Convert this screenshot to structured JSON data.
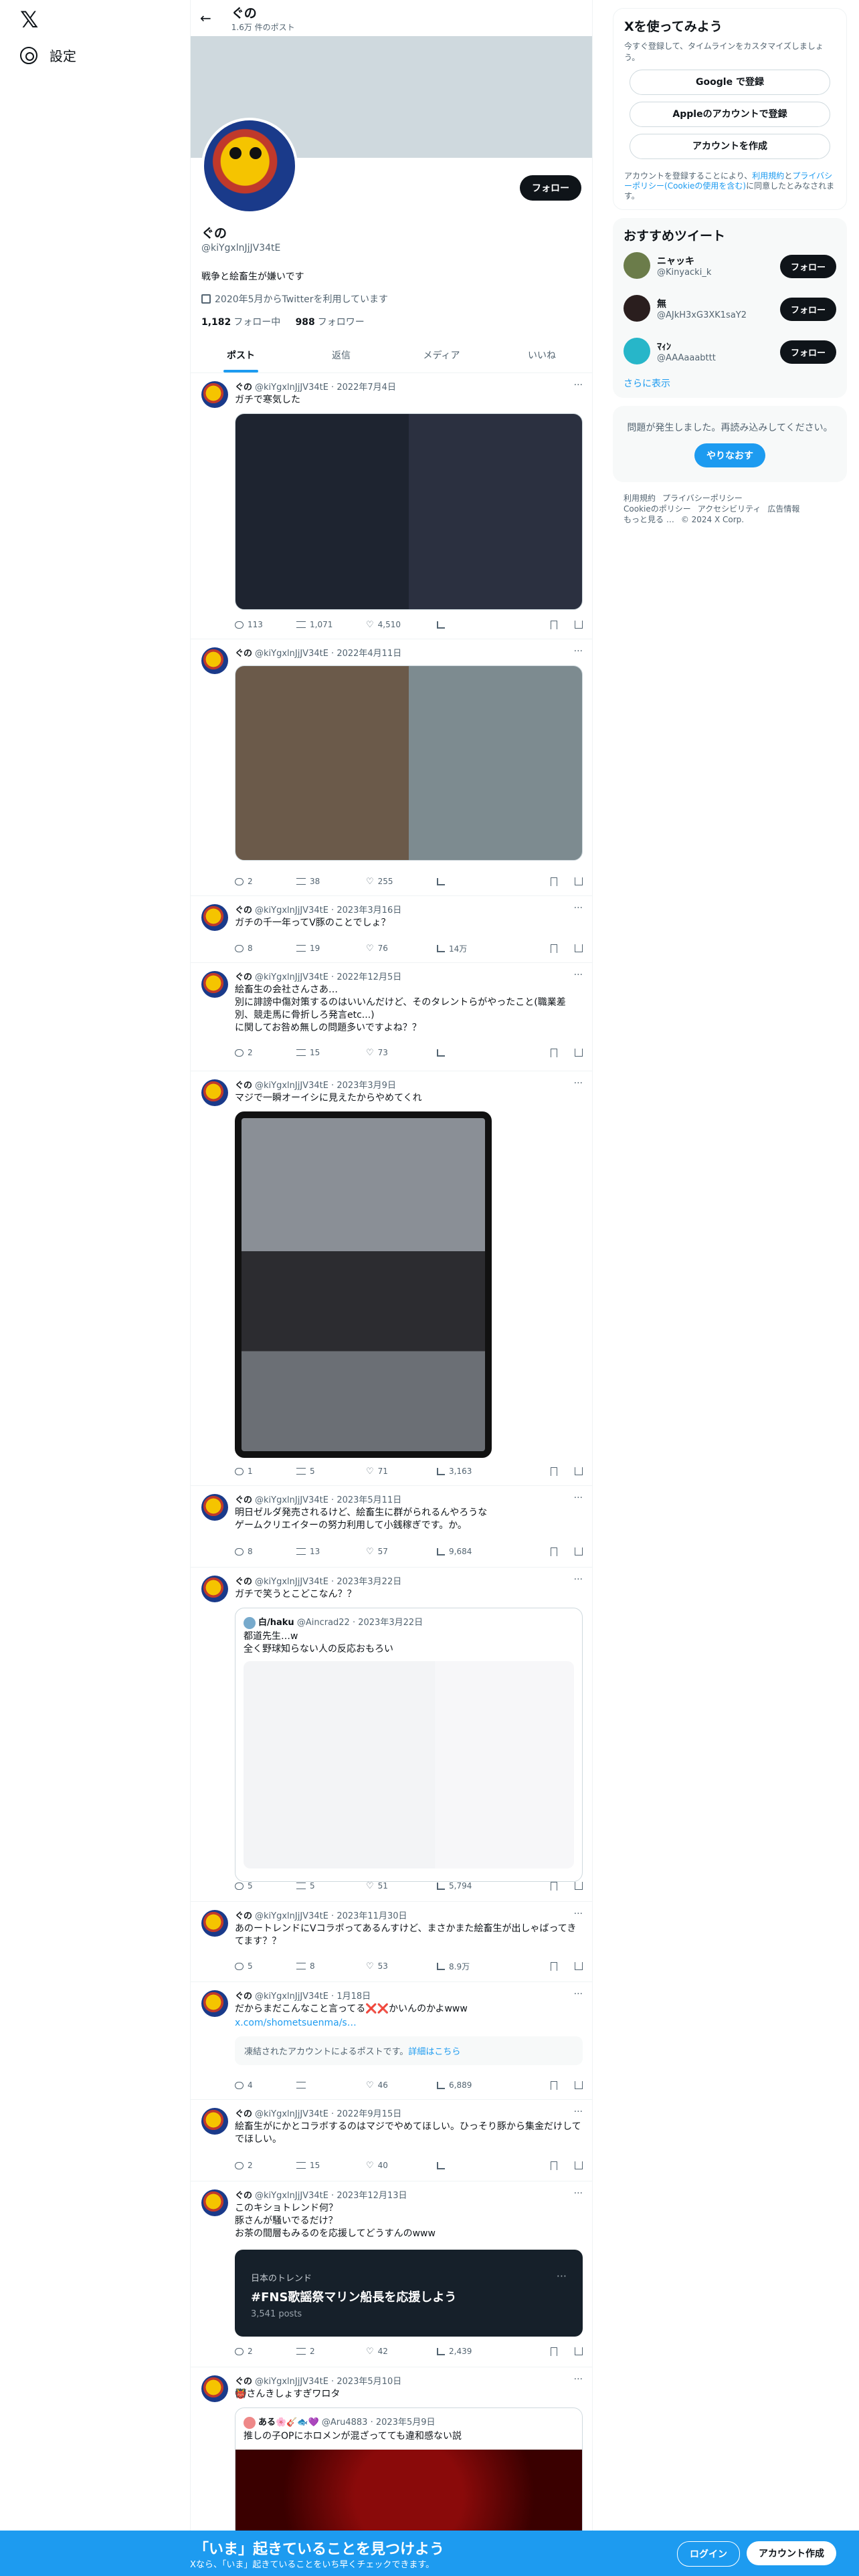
{
  "nav": {
    "logo": "𝕏",
    "settings": "設定"
  },
  "header": {
    "name": "ぐの",
    "posts": "1.6万 件のポスト"
  },
  "profile": {
    "name": "ぐの",
    "handle": "@kiYgxlnJjJV34tE",
    "bio": "戦争と絵畜生が嫌いです",
    "joined": "2020年5月からTwitterを利用しています",
    "following_count": "1,182",
    "following_label": "フォロー中",
    "followers_count": "988",
    "followers_label": "フォロワー",
    "follow_button": "フォロー"
  },
  "tabs": [
    "ポスト",
    "返信",
    "メディア",
    "いいね"
  ],
  "tweets": [
    {
      "name": "ぐの",
      "handle": "@kiYgxlnJjJV34tE",
      "date": "2022年7月4日",
      "text": "ガチで寒気した",
      "reply": "113",
      "rt": "1,071",
      "like": "4,510",
      "view": ""
    },
    {
      "name": "ぐの",
      "handle": "@kiYgxlnJjJV34tE",
      "date": "2022年4月11日",
      "text": "",
      "reply": "2",
      "rt": "38",
      "like": "255",
      "view": ""
    },
    {
      "name": "ぐの",
      "handle": "@kiYgxlnJjJV34tE",
      "date": "2023年3月16日",
      "text": "ガチの千一年ってV豚のことでしょ？",
      "reply": "8",
      "rt": "19",
      "like": "76",
      "view": "14万"
    },
    {
      "name": "ぐの",
      "handle": "@kiYgxlnJjJV34tE",
      "date": "2022年12月5日",
      "text": "絵畜生の会社さんさあ…\n別に誹謗中傷対策するのはいいんだけど、そのタレントらがやったこと(職業差別、競走馬に骨折しろ発言etc...)\nに関してお咎め無しの問題多いですよね？？",
      "reply": "2",
      "rt": "15",
      "like": "73",
      "view": ""
    },
    {
      "name": "ぐの",
      "handle": "@kiYgxlnJjJV34tE",
      "date": "2023年3月9日",
      "text": "マジで一瞬オーイシに見えたからやめてくれ",
      "reply": "1",
      "rt": "5",
      "like": "71",
      "view": "3,163"
    },
    {
      "name": "ぐの",
      "handle": "@kiYgxlnJjJV34tE",
      "date": "2023年5月11日",
      "text": "明日ゼルダ発売されるけど、絵畜生に群がられるんやろうな\nゲームクリエイターの努力利用して小銭稼ぎです。か。",
      "reply": "8",
      "rt": "13",
      "like": "57",
      "view": "9,684"
    },
    {
      "name": "ぐの",
      "handle": "@kiYgxlnJjJV34tE",
      "date": "2023年3月22日",
      "text": "ガチで笑うとこどこなん？？",
      "reply": "5",
      "rt": "5",
      "like": "51",
      "view": "5,794",
      "quote_name": "白/haku",
      "quote_handle": "@Aincrad22",
      "quote_date": "2023年3月22日",
      "quote_text": "都道先生…w\n全く野球知らない人の反応おもろい"
    },
    {
      "name": "ぐの",
      "handle": "@kiYgxlnJjJV34tE",
      "date": "2023年11月30日",
      "text": "あのートレンドにVコラボってあるんすけど、まさかまた絵畜生が出しゃばってきてます？？",
      "reply": "5",
      "rt": "8",
      "like": "53",
      "view": "8.9万"
    },
    {
      "name": "ぐの",
      "handle": "@kiYgxlnJjJV34tE",
      "date": "1月18日",
      "text": "だからまだこんなこと言ってる❌❌かいんのかよwww",
      "link": "x.com/shometsuenma/s…",
      "notice": "凍結されたアカウントによるポストです。",
      "notice_link": "詳細はこちら",
      "reply": "4",
      "rt": "",
      "like": "46",
      "view": "6,889"
    },
    {
      "name": "ぐの",
      "handle": "@kiYgxlnJjJV34tE",
      "date": "2022年9月15日",
      "text": "絵畜生がにかとコラボするのはマジでやめてほしい。ひっそり豚から集金だけしてでほしい。",
      "reply": "2",
      "rt": "15",
      "like": "40",
      "view": ""
    },
    {
      "name": "ぐの",
      "handle": "@kiYgxlnJjJV34tE",
      "date": "2023年12月13日",
      "text": "このキショトレンド何？\n豚さんが騒いでるだけ？\nお茶の間層もみるのを応援してどうすんのwww",
      "trend_label": "日本のトレンド",
      "trend_name": "#FNS歌謡祭マリン船長を応援しよう",
      "trend_posts": "3,541 posts",
      "reply": "2",
      "rt": "2",
      "like": "42",
      "view": "2,439"
    },
    {
      "name": "ぐの",
      "handle": "@kiYgxlnJjJV34tE",
      "date": "2023年5月10日",
      "text": "👹さんきしょすぎワロタ",
      "quote_name": "ある🌸🎸🐟💜",
      "quote_handle": "@Aru4883",
      "quote_date": "2023年5月9日",
      "quote_text": "推しの子OPにホロメンが混ざってても違和感ない説"
    }
  ],
  "sidebar": {
    "signup_title": "Xを使ってみよう",
    "signup_sub": "今すぐ登録して、タイムラインをカスタマイズしましょう。",
    "google": "Google で登録",
    "apple": "Appleのアカウントで登録",
    "create": "アカウントを作成",
    "terms_prefix": "アカウントを登録することにより、",
    "terms_link1": "利用規約",
    "terms_mid": "と",
    "terms_link2": "プライバシーポリシー",
    "terms_link3": "(Cookieの使用を含む)",
    "terms_suffix": "に同意したとみなされます。",
    "rec_title": "おすすめツイート",
    "recs": [
      {
        "name": "ニャッキ",
        "handle": "@Kinyacki_k",
        "btn": "フォロー"
      },
      {
        "name": "無",
        "handle": "@AJkH3xG3XK1saY2",
        "btn": "フォロー"
      },
      {
        "name": "ﾏｨﾝ",
        "handle": "@AAAaaabttt",
        "btn": "フォロー"
      }
    ],
    "show_more": "さらに表示",
    "error": "問題が発生しました。再読み込みしてください。",
    "retry": "やりなおす",
    "footer": [
      "利用規約",
      "プライバシーポリシー",
      "Cookieのポリシー",
      "アクセシビリティ",
      "広告情報",
      "もっと見る …",
      "© 2024 X Corp."
    ]
  },
  "bottom": {
    "title": "「いま」起きていることを見つけよう",
    "sub": "Xなら、「いま」起きていることをいち早くチェックできます。",
    "login": "ログイン",
    "signup": "アカウント作成"
  }
}
